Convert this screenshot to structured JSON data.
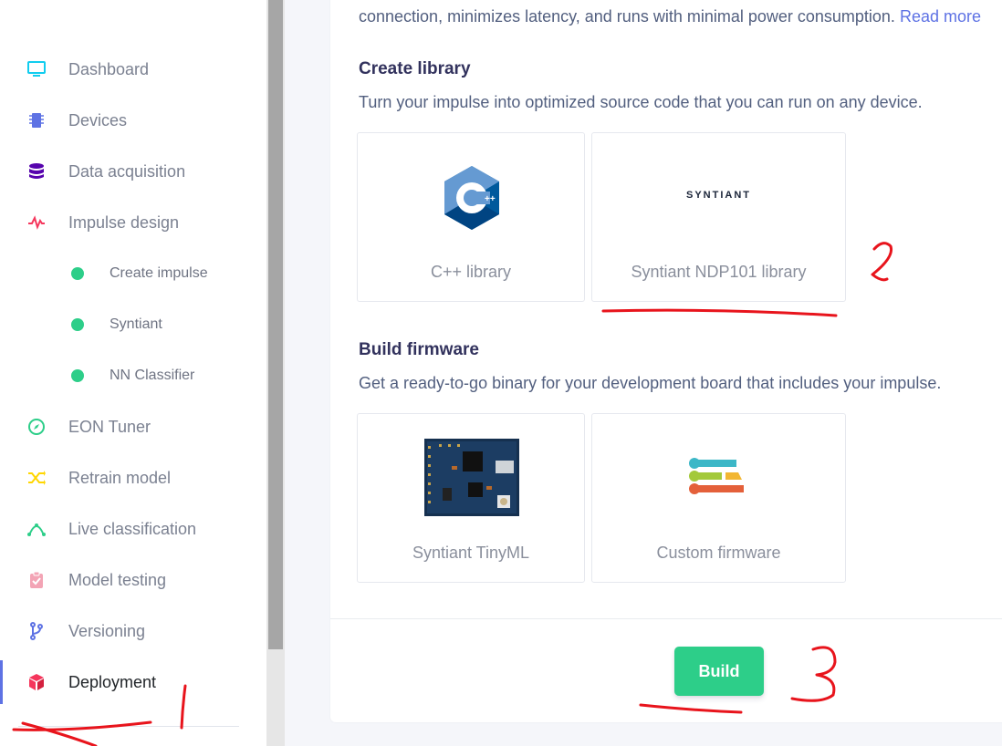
{
  "sidebar": {
    "items": [
      {
        "label": "Dashboard",
        "icon": "monitor-icon",
        "color": "#11cdef"
      },
      {
        "label": "Devices",
        "icon": "chip-icon",
        "color": "#5e72e4"
      },
      {
        "label": "Data acquisition",
        "icon": "database-icon",
        "color": "#5603ad"
      },
      {
        "label": "Impulse design",
        "icon": "pulse-icon",
        "color": "#f5365c"
      },
      {
        "label": "Create impulse",
        "icon": "dot-icon",
        "color": "#2dce89"
      },
      {
        "label": "Syntiant",
        "icon": "dot-icon",
        "color": "#2dce89"
      },
      {
        "label": "NN Classifier",
        "icon": "dot-icon",
        "color": "#2dce89"
      },
      {
        "label": "EON Tuner",
        "icon": "compass-icon",
        "color": "#2dce89"
      },
      {
        "label": "Retrain model",
        "icon": "shuffle-icon",
        "color": "#ffd600"
      },
      {
        "label": "Live classification",
        "icon": "curve-icon",
        "color": "#2dce89"
      },
      {
        "label": "Model testing",
        "icon": "clipboard-check-icon",
        "color": "#f3a4b5"
      },
      {
        "label": "Versioning",
        "icon": "branch-icon",
        "color": "#5e72e4"
      },
      {
        "label": "Deployment",
        "icon": "cube-icon",
        "color": "#f5365c"
      }
    ]
  },
  "intro": {
    "text": "connection, minimizes latency, and runs with minimal power consumption.",
    "link": "Read more"
  },
  "library": {
    "title": "Create library",
    "description": "Turn your impulse into optimized source code that you can run on any device.",
    "options": [
      {
        "label": "C++ library",
        "logo_text": "C++"
      },
      {
        "label": "Syntiant NDP101 library",
        "logo_text": "SYNTIANT"
      }
    ]
  },
  "firmware": {
    "title": "Build firmware",
    "description": "Get a ready-to-go binary for your development board that includes your impulse.",
    "options": [
      {
        "label": "Syntiant TinyML"
      },
      {
        "label": "Custom firmware"
      }
    ]
  },
  "build_button": "Build",
  "annotation_color": "#e8141c"
}
